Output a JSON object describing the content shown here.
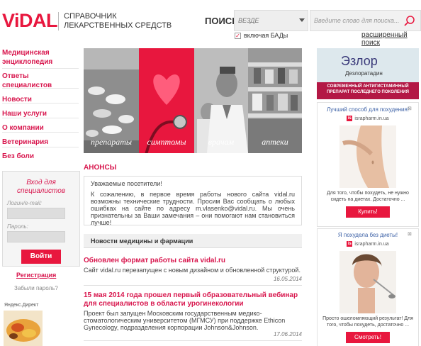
{
  "header": {
    "logo": "ViDAL",
    "subtitle_line1": "Справочник",
    "subtitle_line2": "лекарственных средств",
    "search_label": "ПОИСК:",
    "search_scope": "ВЕЗДЕ",
    "search_placeholder": "Введите слово для поиска...",
    "include_bad_label": "включая БАДы",
    "include_bad_checked": true,
    "advanced_search": "расширенный поиск"
  },
  "left_nav": [
    {
      "label": "Медицинская энциклопедия"
    },
    {
      "label": "Ответы специалистов"
    },
    {
      "label": "Новости"
    },
    {
      "label": "Наши услуги"
    },
    {
      "label": "О компании"
    },
    {
      "label": "Ветеринария"
    },
    {
      "label": "Без боли"
    }
  ],
  "login": {
    "title": "Вход для специалистов",
    "login_label": "Логин/e-mail:",
    "password_label": "Пароль:",
    "submit": "Войти",
    "register": "Регистрация",
    "forgot": "Забыли пароль?"
  },
  "yandex_direct": "Яндекс.Директ",
  "banner": {
    "panels": [
      "препараты",
      "симптомы",
      "врачам",
      "аптеки"
    ]
  },
  "anons": {
    "title": "АНОНСЫ",
    "greeting": "Уважаемые посетители!",
    "text": "К сожалению, в первое время работы нового сайта vidal.ru возможны технические трудности. Просим Вас сообщать о любых ошибках на сайте по адресу m.vlasenko@vidal.ru. Мы очень признательны за Ваши замечания – они помогают нам становиться лучше!"
  },
  "news": {
    "header": "Новости медицины и фармации",
    "items": [
      {
        "title": "Обновлен формат работы сайта vidal.ru",
        "body": "Сайт vidal.ru перезапущен с новым дизайном и обновленной структурой.",
        "date": "16.05.2014"
      },
      {
        "title": "15 мая 2014 года прошел первый образовательный вебинар для специалистов в области урогинекологии",
        "body": "Проект был запущен Московским государственным медико-стоматологическим университетом (МГМСУ) при поддержке Ethicon Gynecology, подразделения корпорации Johnson&Johnson.",
        "date": "17.06.2014"
      }
    ]
  },
  "right": {
    "ezlor": {
      "name": "Эзлор",
      "sub": "Дезлоратадин",
      "tagline": "СОВРЕМЕННЫЙ АНТИГИСТАМИННЫЙ ПРЕПАРАТ ПОСЛЕДНЕГО ПОКОЛЕНИЯ"
    },
    "ads": [
      {
        "title": "Лучший способ для похудения!",
        "domain": "israpharm.in.ua",
        "text": "Для того, чтобы похудеть, не нужно сидеть на диетах. Достаточно ...",
        "button": "Купить!"
      },
      {
        "title": "Я похудела без диеты!",
        "domain": "israpharm.in.ua",
        "text": "Просто ошеломляющий результат! Для того, чтобы похудеть, достаточно ...",
        "button": "Смотреть!"
      }
    ]
  },
  "colors": {
    "brand": "#e8173e",
    "link": "#d8174e",
    "ad_link": "#3a5fa5"
  }
}
